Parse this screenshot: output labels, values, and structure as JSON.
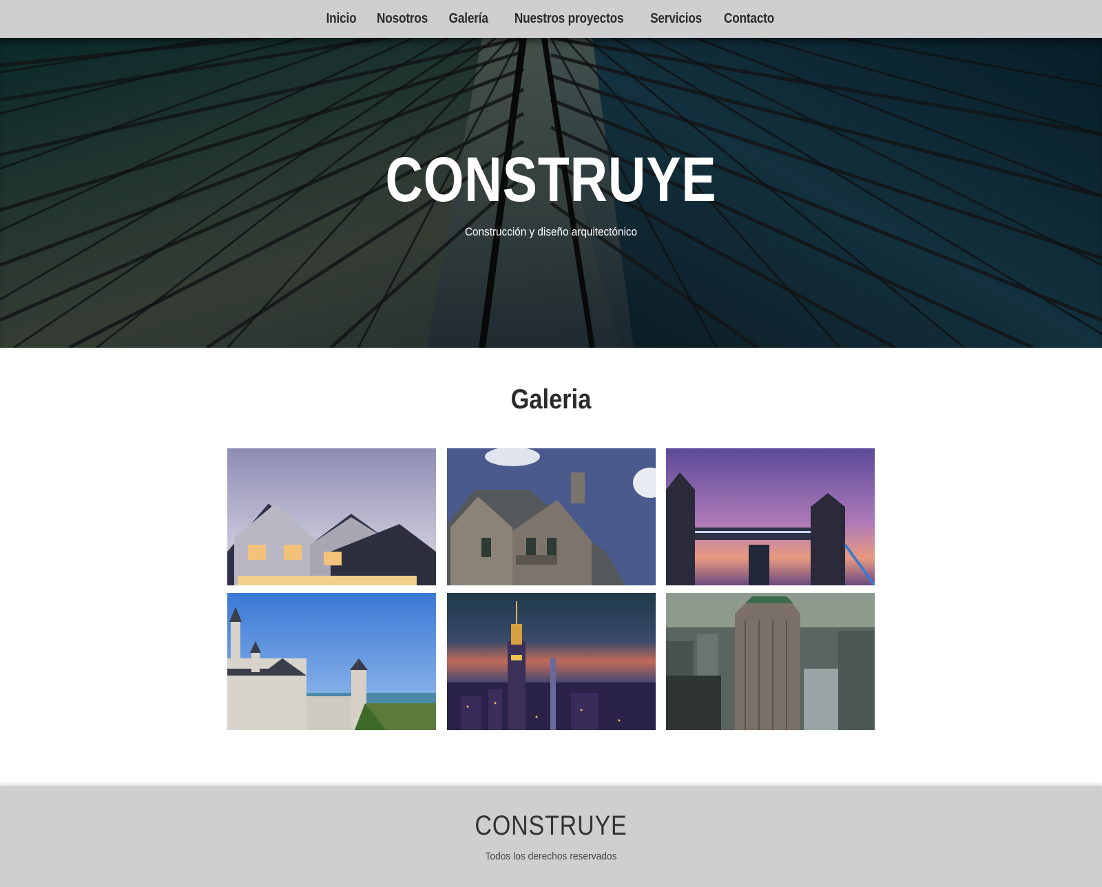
{
  "nav": {
    "items": [
      {
        "label": "Inicio"
      },
      {
        "label": "Nosotros"
      },
      {
        "label": "Galería"
      },
      {
        "label": "Nuestros proyectos"
      },
      {
        "label": "Servicios"
      },
      {
        "label": "Contacto"
      }
    ]
  },
  "hero": {
    "title": "CONSTRUYE",
    "subtitle": "Construcción y diseño arquitectónico"
  },
  "gallery": {
    "title": "Galeria",
    "images": [
      {
        "icon": "suburban-house-image"
      },
      {
        "icon": "stone-cottage-image"
      },
      {
        "icon": "tower-bridge-image"
      },
      {
        "icon": "castle-image"
      },
      {
        "icon": "empire-state-night-image"
      },
      {
        "icon": "city-skyscraper-image"
      }
    ]
  },
  "footer": {
    "title": "CONSTRUYE",
    "copyright": "Todos los derechos reservados"
  },
  "colors": {
    "nav_bg": "#cfcfcf",
    "footer_bg": "#cfcfcf",
    "text_dark": "#2b2b2b",
    "hero_text": "#ffffff"
  }
}
